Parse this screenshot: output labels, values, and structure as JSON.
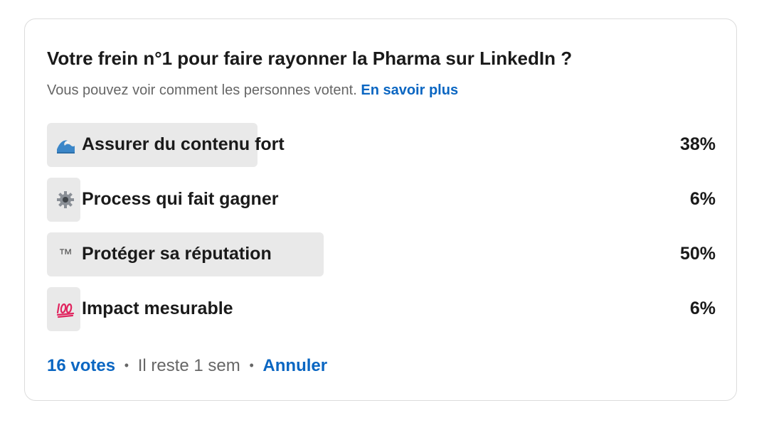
{
  "poll": {
    "question": "Votre frein n°1 pour faire rayonner la Pharma sur LinkedIn ?",
    "subtitle_text": "Vous pouvez voir comment les personnes votent.",
    "learn_more_label": "En savoir plus",
    "options": [
      {
        "icon": "wave-icon",
        "label": "Assurer du contenu fort",
        "percent_label": "38%",
        "percent": 38
      },
      {
        "icon": "gear-icon",
        "label": "Process qui fait gagner",
        "percent_label": "6%",
        "percent": 6
      },
      {
        "icon": "trademark-icon",
        "icon_text": "™",
        "label": "Protéger sa réputation",
        "percent_label": "50%",
        "percent": 50
      },
      {
        "icon": "hundred-points-icon",
        "label": "Impact mesurable",
        "percent_label": "6%",
        "percent": 6
      }
    ],
    "footer": {
      "votes_label": "16 votes",
      "separator": "•",
      "time_left": "Il reste 1 sem",
      "cancel_label": "Annuler"
    }
  },
  "colors": {
    "link": "#0a66c2",
    "bar": "#e9e9e9",
    "text": "#1a1a1a",
    "muted": "#666666",
    "border": "#dcdcdc"
  }
}
